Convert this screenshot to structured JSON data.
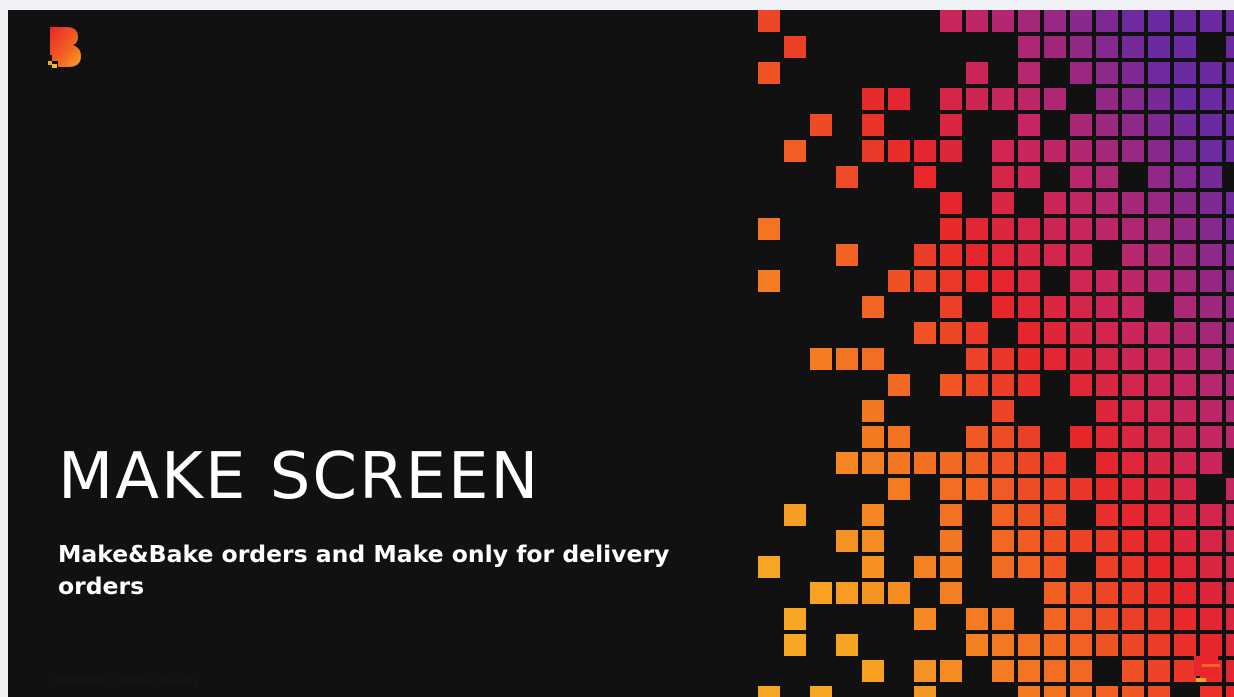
{
  "slide": {
    "title": "MAKE SCREEN",
    "subtitle": "Make&Bake orders and Make only for delivery orders",
    "footer": "Confidential - Internal use only",
    "background_color": "#111111"
  },
  "brand": {
    "logo_icon": "brand-b-logo-icon",
    "colors": {
      "orange": "#f5a623",
      "red": "#e8262b",
      "magenta": "#c0266a",
      "purple": "#6a2aa0"
    }
  },
  "decoration": {
    "pattern": "pixel-mosaic-gradient",
    "gradient_colors": [
      "#f5a623",
      "#e8262b",
      "#6a2aa0"
    ]
  }
}
